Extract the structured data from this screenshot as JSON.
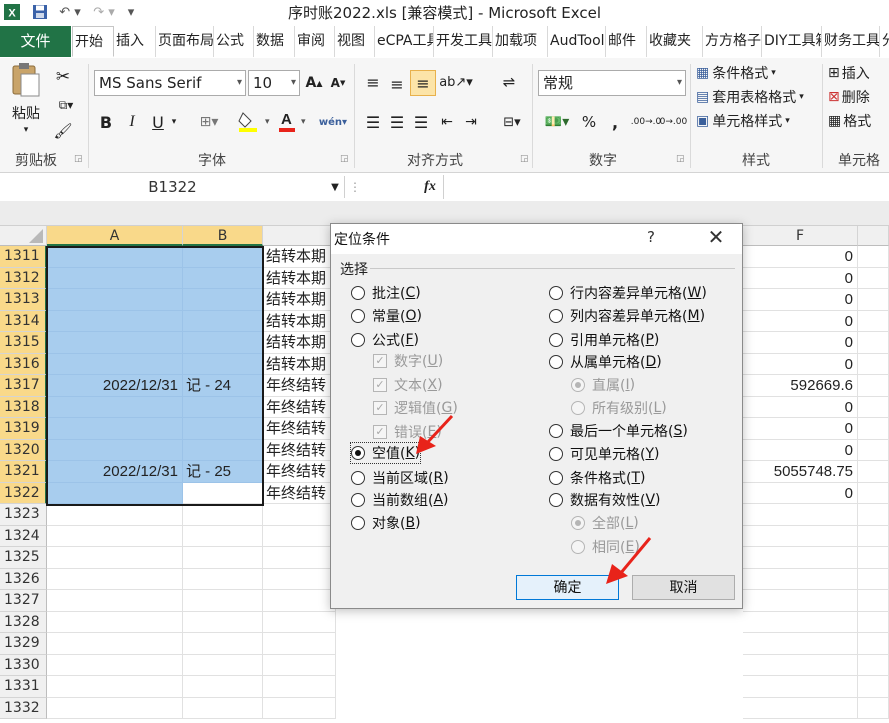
{
  "window": {
    "title": "序时账2022.xls  [兼容模式]  -  Microsoft Excel"
  },
  "ribbon_tabs": [
    "文件",
    "开始",
    "插入",
    "页面布局",
    "公式",
    "数据",
    "审阅",
    "视图",
    "eCPA工具",
    "开发工具",
    "加载项",
    "AudTool",
    "邮件",
    "收藏夹",
    "方方格子",
    "DIY工具箱",
    "财务工具",
    "分"
  ],
  "clipboard": {
    "paste": "粘贴",
    "group": "剪贴板"
  },
  "font": {
    "name": "MS Sans Serif",
    "size": "10",
    "group": "字体",
    "bold": "B",
    "italic": "I",
    "underline": "U",
    "wen": "wén"
  },
  "alignment": {
    "group": "对齐方式"
  },
  "number": {
    "format": "常规",
    "group": "数字",
    "percent": "%",
    "comma": ",",
    "dec_inc": ".00→.0",
    "dec_dec": ".0→.00"
  },
  "styles": {
    "conditional": "条件格式",
    "table": "套用表格格式",
    "cell": "单元格样式",
    "group": "样式"
  },
  "cells": {
    "insert": "插入",
    "delete": "删除",
    "format": "格式",
    "group": "单元格"
  },
  "formula_bar": {
    "name_box": "B1322",
    "fx": "fx",
    "value": ""
  },
  "grid": {
    "col_headers": [
      "A",
      "B",
      "",
      "",
      "",
      "F"
    ],
    "rows": [
      {
        "num": "1311",
        "a": "",
        "b": "",
        "c": "结转本期",
        "f": "0"
      },
      {
        "num": "1312",
        "a": "",
        "b": "",
        "c": "结转本期",
        "f": "0"
      },
      {
        "num": "1313",
        "a": "",
        "b": "",
        "c": "结转本期",
        "f": "0"
      },
      {
        "num": "1314",
        "a": "",
        "b": "",
        "c": "结转本期",
        "f": "0"
      },
      {
        "num": "1315",
        "a": "",
        "b": "",
        "c": "结转本期",
        "f": "0"
      },
      {
        "num": "1316",
        "a": "",
        "b": "",
        "c": "结转本期",
        "f": "0"
      },
      {
        "num": "1317",
        "a": "2022/12/31",
        "b": "记 - 24",
        "c": "年终结转",
        "f": "592669.6"
      },
      {
        "num": "1318",
        "a": "",
        "b": "",
        "c": "年终结转",
        "f": "0"
      },
      {
        "num": "1319",
        "a": "",
        "b": "",
        "c": "年终结转",
        "f": "0"
      },
      {
        "num": "1320",
        "a": "",
        "b": "",
        "c": "年终结转",
        "f": "0"
      },
      {
        "num": "1321",
        "a": "2022/12/31",
        "b": "记 - 25",
        "c": "年终结转",
        "f": "5055748.75"
      },
      {
        "num": "1322",
        "a": "",
        "b": "",
        "c": "年终结转",
        "f": "0"
      },
      {
        "num": "1323",
        "a": "",
        "b": "",
        "c": "",
        "f": ""
      },
      {
        "num": "1324",
        "a": "",
        "b": "",
        "c": "",
        "f": ""
      },
      {
        "num": "1325",
        "a": "",
        "b": "",
        "c": "",
        "f": ""
      },
      {
        "num": "1326",
        "a": "",
        "b": "",
        "c": "",
        "f": ""
      },
      {
        "num": "1327",
        "a": "",
        "b": "",
        "c": "",
        "f": ""
      },
      {
        "num": "1328",
        "a": "",
        "b": "",
        "c": "",
        "f": ""
      },
      {
        "num": "1329",
        "a": "",
        "b": "",
        "c": "",
        "f": ""
      },
      {
        "num": "1330",
        "a": "",
        "b": "",
        "c": "",
        "f": ""
      },
      {
        "num": "1331",
        "a": "",
        "b": "",
        "c": "",
        "f": ""
      },
      {
        "num": "1332",
        "a": "",
        "b": "",
        "c": "",
        "f": ""
      }
    ]
  },
  "dialog": {
    "title": "定位条件",
    "help": "?",
    "group_label": "选择",
    "left_options": [
      {
        "id": "comments",
        "label": "批注(",
        "key": "C",
        "tail": ")",
        "type": "radio",
        "checked": false,
        "disabled": false
      },
      {
        "id": "constants",
        "label": "常量(",
        "key": "O",
        "tail": ")",
        "type": "radio",
        "checked": false,
        "disabled": false
      },
      {
        "id": "formulas",
        "label": "公式(",
        "key": "F",
        "tail": ")",
        "type": "radio",
        "checked": false,
        "disabled": false
      },
      {
        "id": "numbers",
        "label": "数字(",
        "key": "U",
        "tail": ")",
        "type": "check",
        "checked": true,
        "disabled": true
      },
      {
        "id": "text",
        "label": "文本(",
        "key": "X",
        "tail": ")",
        "type": "check",
        "checked": true,
        "disabled": true
      },
      {
        "id": "logicals",
        "label": "逻辑值(",
        "key": "G",
        "tail": ")",
        "type": "check",
        "checked": true,
        "disabled": true
      },
      {
        "id": "errors",
        "label": "错误(",
        "key": "E",
        "tail": ")",
        "type": "check",
        "checked": true,
        "disabled": true
      },
      {
        "id": "blanks",
        "label": "空值(",
        "key": "K",
        "tail": ")",
        "type": "radio",
        "checked": true,
        "disabled": false
      },
      {
        "id": "current-region",
        "label": "当前区域(",
        "key": "R",
        "tail": ")",
        "type": "radio",
        "checked": false,
        "disabled": false
      },
      {
        "id": "current-array",
        "label": "当前数组(",
        "key": "A",
        "tail": ")",
        "type": "radio",
        "checked": false,
        "disabled": false
      },
      {
        "id": "objects",
        "label": "对象(",
        "key": "B",
        "tail": ")",
        "type": "radio",
        "checked": false,
        "disabled": false
      }
    ],
    "right_options": [
      {
        "id": "row-differences",
        "label": "行内容差异单元格(",
        "key": "W",
        "tail": ")",
        "type": "radio",
        "checked": false,
        "disabled": false
      },
      {
        "id": "column-differences",
        "label": "列内容差异单元格(",
        "key": "M",
        "tail": ")",
        "type": "radio",
        "checked": false,
        "disabled": false
      },
      {
        "id": "precedents",
        "label": "引用单元格(",
        "key": "P",
        "tail": ")",
        "type": "radio",
        "checked": false,
        "disabled": false
      },
      {
        "id": "dependents",
        "label": "从属单元格(",
        "key": "D",
        "tail": ")",
        "type": "radio",
        "checked": false,
        "disabled": false
      },
      {
        "id": "direct-only",
        "label": "直属(",
        "key": "I",
        "tail": ")",
        "type": "radio",
        "checked": true,
        "disabled": true
      },
      {
        "id": "all-levels",
        "label": "所有级别(",
        "key": "L",
        "tail": ")",
        "type": "radio",
        "checked": false,
        "disabled": true
      },
      {
        "id": "last-cell",
        "label": "最后一个单元格(",
        "key": "S",
        "tail": ")",
        "type": "radio",
        "checked": false,
        "disabled": false
      },
      {
        "id": "visible-cells",
        "label": "可见单元格(",
        "key": "Y",
        "tail": ")",
        "type": "radio",
        "checked": false,
        "disabled": false
      },
      {
        "id": "conditional-formats",
        "label": "条件格式(",
        "key": "T",
        "tail": ")",
        "type": "radio",
        "checked": false,
        "disabled": false
      },
      {
        "id": "data-validation",
        "label": "数据有效性(",
        "key": "V",
        "tail": ")",
        "type": "radio",
        "checked": false,
        "disabled": false
      },
      {
        "id": "validation-all",
        "label": "全部(",
        "key": "L",
        "tail": ")",
        "type": "radio",
        "checked": true,
        "disabled": true
      },
      {
        "id": "validation-same",
        "label": "相同(",
        "key": "E",
        "tail": ")",
        "type": "radio",
        "checked": false,
        "disabled": true
      }
    ],
    "ok": "确定",
    "cancel": "取消"
  },
  "colors": {
    "accent": "#217346",
    "selection": "#a8cdee",
    "header_selected": "#f9d98a",
    "annotation": "#e8231a"
  }
}
